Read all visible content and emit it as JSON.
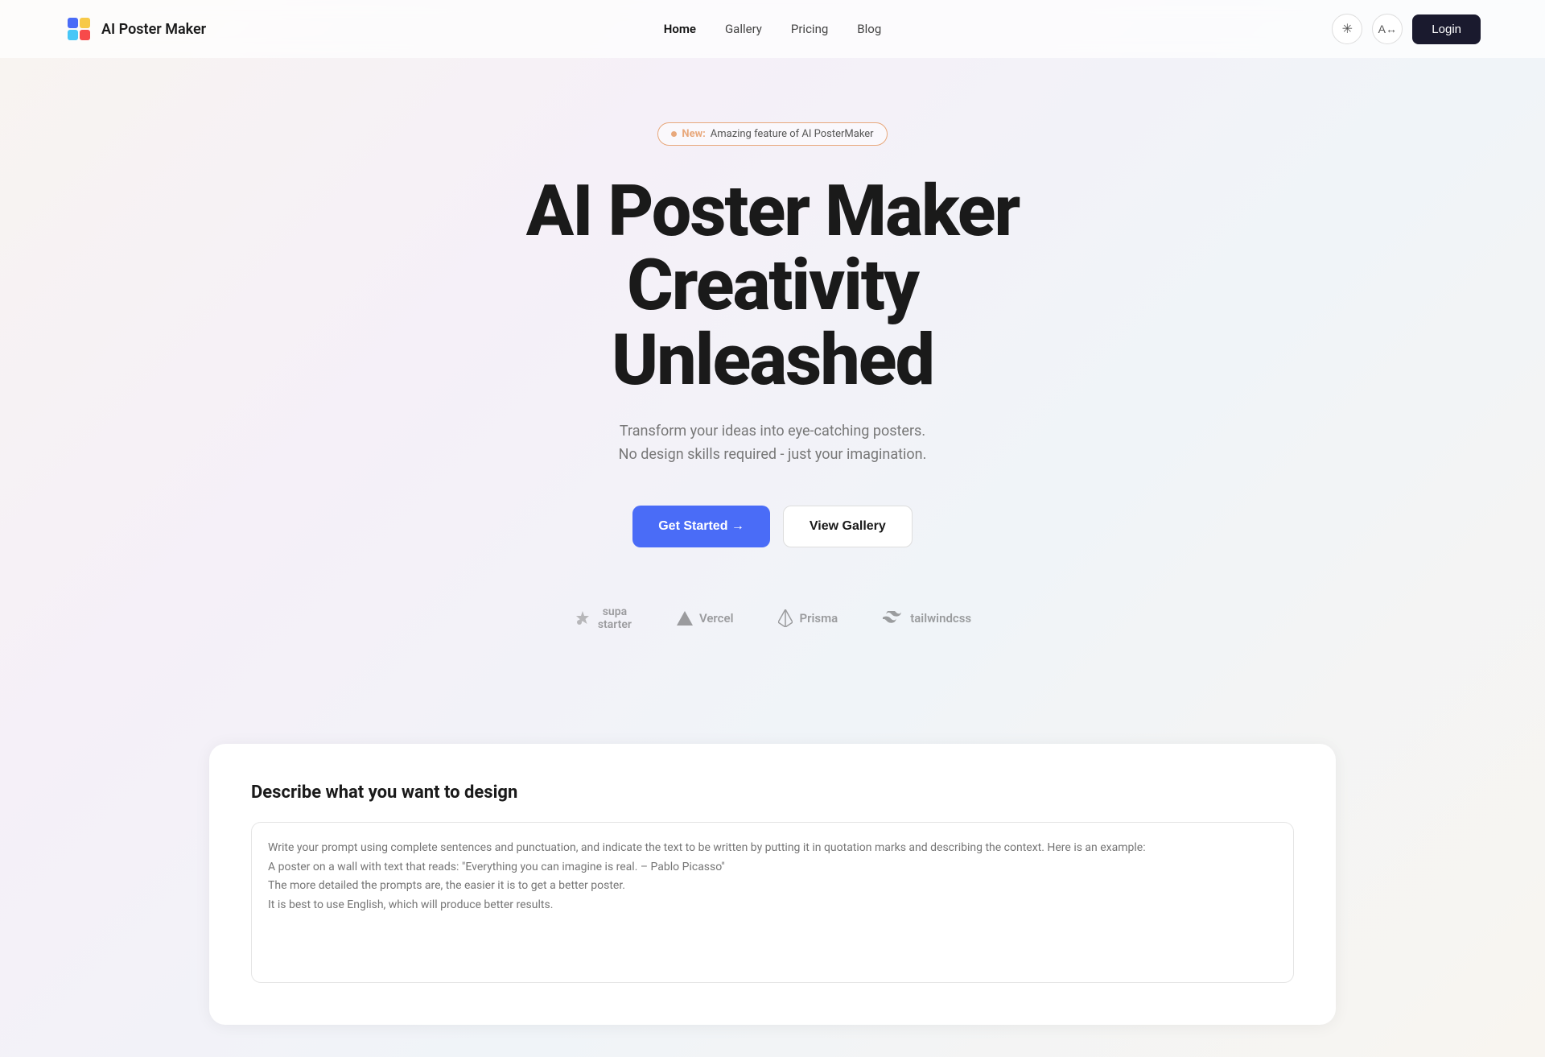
{
  "nav": {
    "brand": "AI Poster Maker",
    "links": [
      {
        "label": "Home",
        "active": true
      },
      {
        "label": "Gallery",
        "active": false
      },
      {
        "label": "Pricing",
        "active": false
      },
      {
        "label": "Blog",
        "active": false
      }
    ],
    "login_label": "Login"
  },
  "hero": {
    "badge": {
      "new_label": "New:",
      "description": "Amazing feature of AI PosterMaker"
    },
    "title_line1": "AI Poster Maker",
    "title_line2": "Creativity",
    "title_line3": "Unleashed",
    "subtitle_line1": "Transform your ideas into eye-catching posters.",
    "subtitle_line2": "No design skills required - just your imagination.",
    "btn_get_started": "Get Started →",
    "btn_view_gallery": "View Gallery"
  },
  "brands": [
    {
      "name": "supastarter"
    },
    {
      "name": "Vercel"
    },
    {
      "name": "Prisma"
    },
    {
      "name": "tailwindcss"
    }
  ],
  "design_section": {
    "title": "Describe what you want to design",
    "placeholder": "Write your prompt using complete sentences and punctuation, and indicate the text to be written by putting it in quotation marks and describing the context. Here is an example:\nA poster on a wall with text that reads: \"Everything you can imagine is real. – Pablo Picasso\"\nThe more detailed the prompts are, the easier it is to get a better poster.\nIt is best to use English, which will produce better results."
  },
  "colors": {
    "primary": "#4a6cf7",
    "dark": "#1a1a2e",
    "badge_border": "#e8a87c",
    "badge_dot": "#e8a87c"
  }
}
